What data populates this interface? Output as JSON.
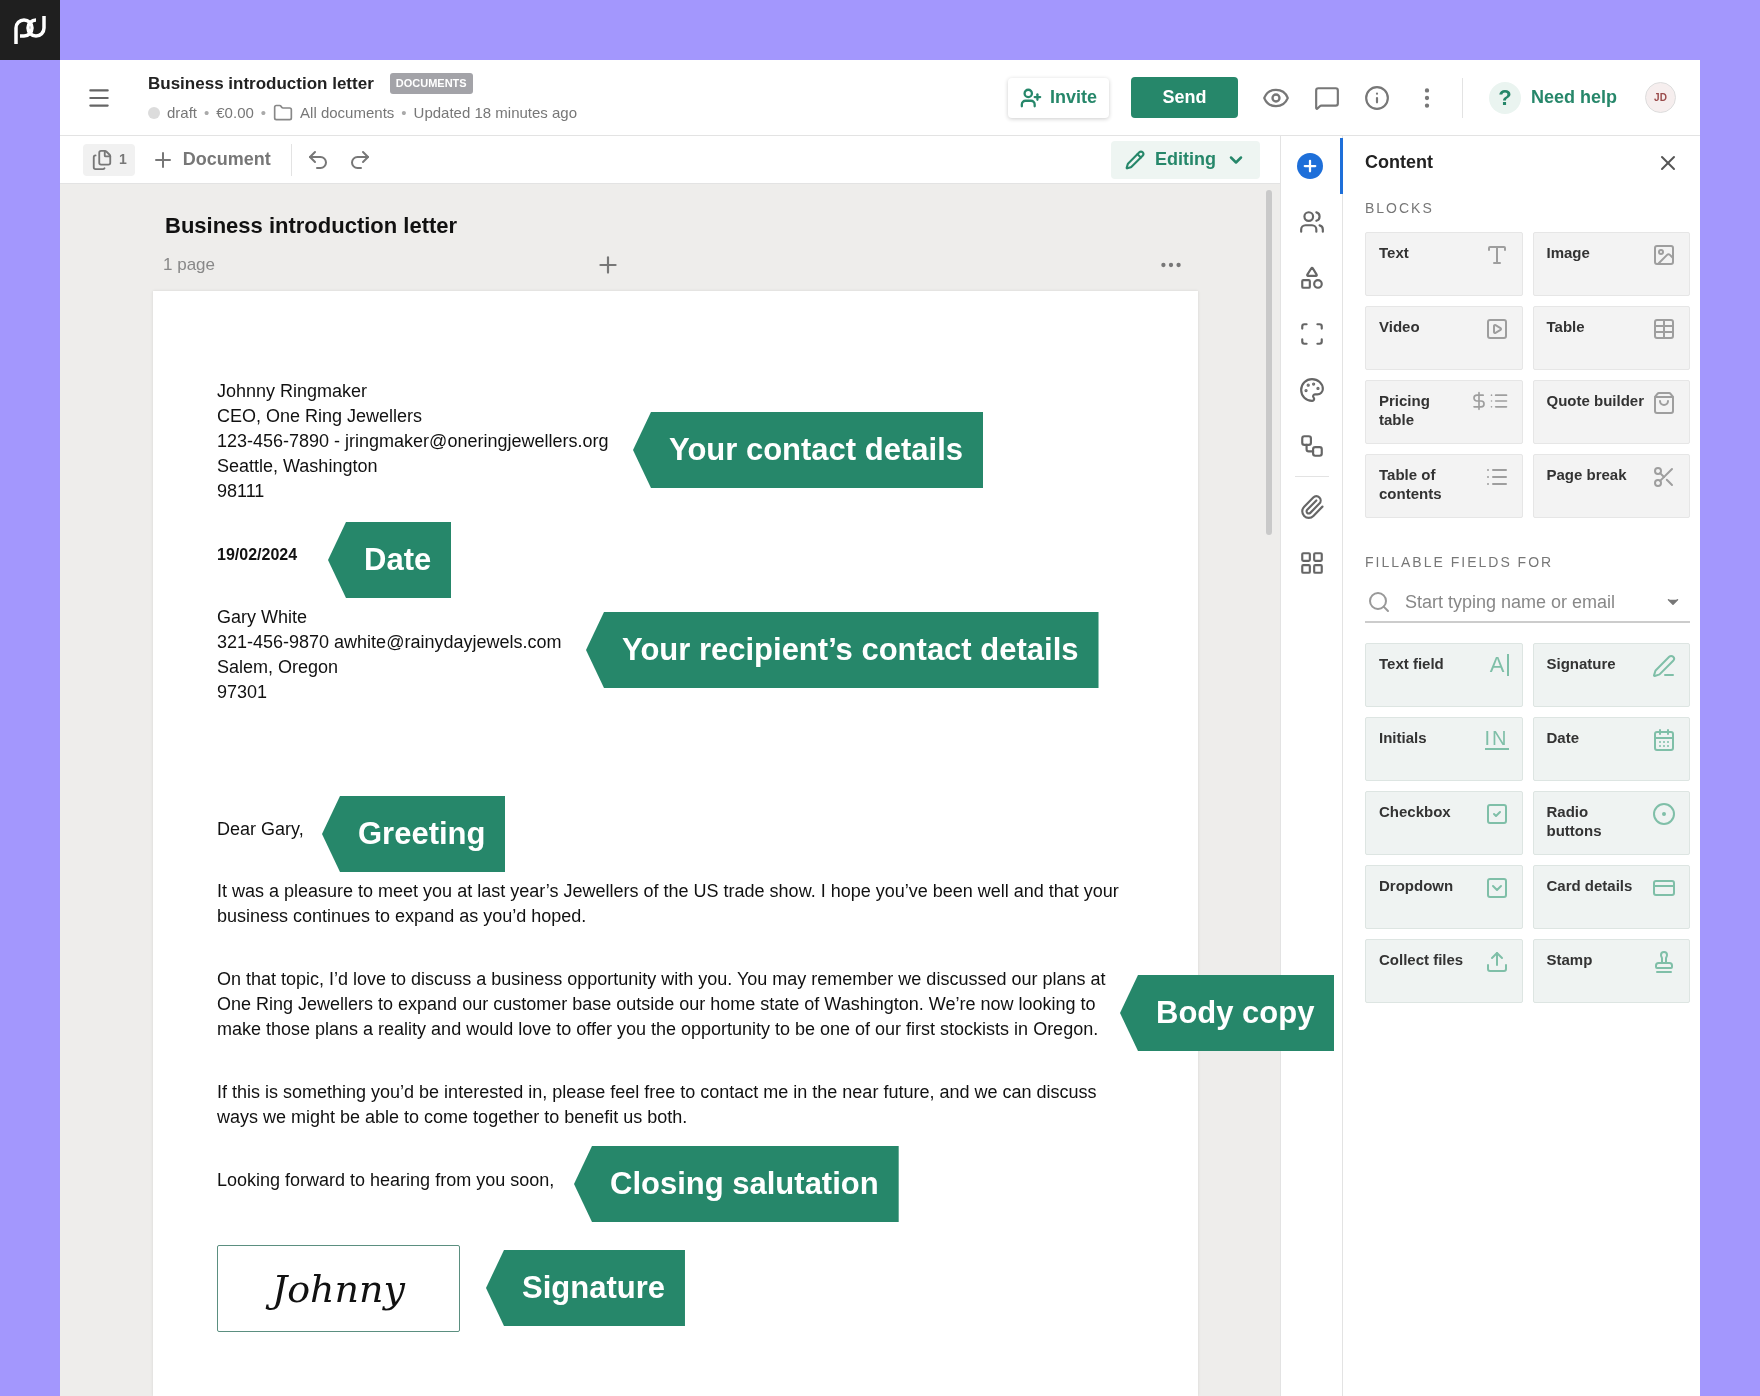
{
  "header": {
    "title": "Business introduction letter",
    "tag": "DOCUMENTS",
    "status": "draft",
    "price": "€0.00",
    "folder": "All documents",
    "updated": "Updated 18 minutes ago",
    "invite": "Invite",
    "send": "Send",
    "help": "Need help",
    "help_icon": "?",
    "separator": "•",
    "avatar": "JD"
  },
  "toolbar": {
    "page_count": "1",
    "add": "Document",
    "mode": "Editing"
  },
  "document": {
    "title": "Business introduction letter",
    "pages": "1 page"
  },
  "letter": {
    "sender": [
      "Johnny Ringmaker",
      "CEO, One Ring Jewellers",
      "123-456-7890 - jringmaker@oneringjewellers.org",
      "Seattle, Washington",
      "98111"
    ],
    "date": "19/02/2024",
    "recipient": [
      "Gary White",
      "321-456-9870 awhite@rainydayjewels.com",
      "Salem, Oregon",
      "97301"
    ],
    "greeting": "Dear Gary,",
    "paragraphs": [
      "It was a pleasure to meet you at last year’s Jewellers of the US trade show. I hope you’ve been well and that your business continues to expand as you’d hoped.",
      "On that topic, I’d love to discuss a business opportunity with you. You may remember we discussed our plans at One Ring Jewellers to expand our customer base outside our home state of Washington. We’re now looking to make those plans a reality and would love to offer you the opportunity to be one of our first stockists in Oregon.",
      "If this is something you’d be interested in, please feel free to contact me in the near future, and we can discuss ways we might be able to come together to benefit us both."
    ],
    "closing": "Looking forward to hearing from you soon,",
    "signature": "Johnny"
  },
  "rail": [
    {
      "kind": "add",
      "selected": true
    },
    {
      "kind": "people",
      "selected": false
    },
    {
      "kind": "shapes",
      "selected": false
    },
    {
      "kind": "frame",
      "selected": false
    },
    {
      "kind": "palette",
      "selected": false
    },
    {
      "kind": "workflow",
      "selected": false
    },
    {
      "kind": "attachment",
      "selected": false
    },
    {
      "kind": "widgets",
      "selected": false
    }
  ],
  "panel": {
    "title": "Content",
    "blocks_heading": "BLOCKS",
    "blocks": [
      {
        "label": "Text",
        "kind": "text"
      },
      {
        "label": "Image",
        "kind": "image"
      },
      {
        "label": "Video",
        "kind": "video"
      },
      {
        "label": "Table",
        "kind": "table"
      },
      {
        "label": "Pricing table",
        "kind": "pricing"
      },
      {
        "label": "Quote builder",
        "kind": "quote"
      },
      {
        "label": "Table of contents",
        "kind": "toc"
      },
      {
        "label": "Page break",
        "kind": "pagebreak"
      }
    ],
    "fields_heading": "FILLABLE FIELDS FOR",
    "search": {
      "placeholder": "Start typing name or email"
    },
    "fields": [
      {
        "label": "Text field",
        "kind": "textfield",
        "glyph": "A"
      },
      {
        "label": "Signature",
        "kind": "signature"
      },
      {
        "label": "Initials",
        "kind": "initials",
        "glyph": "IN"
      },
      {
        "label": "Date",
        "kind": "date"
      },
      {
        "label": "Checkbox",
        "kind": "checkbox"
      },
      {
        "label": "Radio buttons",
        "kind": "radio"
      },
      {
        "label": "Dropdown",
        "kind": "dropdown"
      },
      {
        "label": "Card details",
        "kind": "card"
      },
      {
        "label": "Collect files",
        "kind": "upload"
      },
      {
        "label": "Stamp",
        "kind": "stamp"
      }
    ]
  },
  "callouts": [
    "Your contact details",
    "Date",
    "Your recipient’s contact details",
    "Greeting",
    "Body copy",
    "Closing salutation",
    "Signature"
  ]
}
